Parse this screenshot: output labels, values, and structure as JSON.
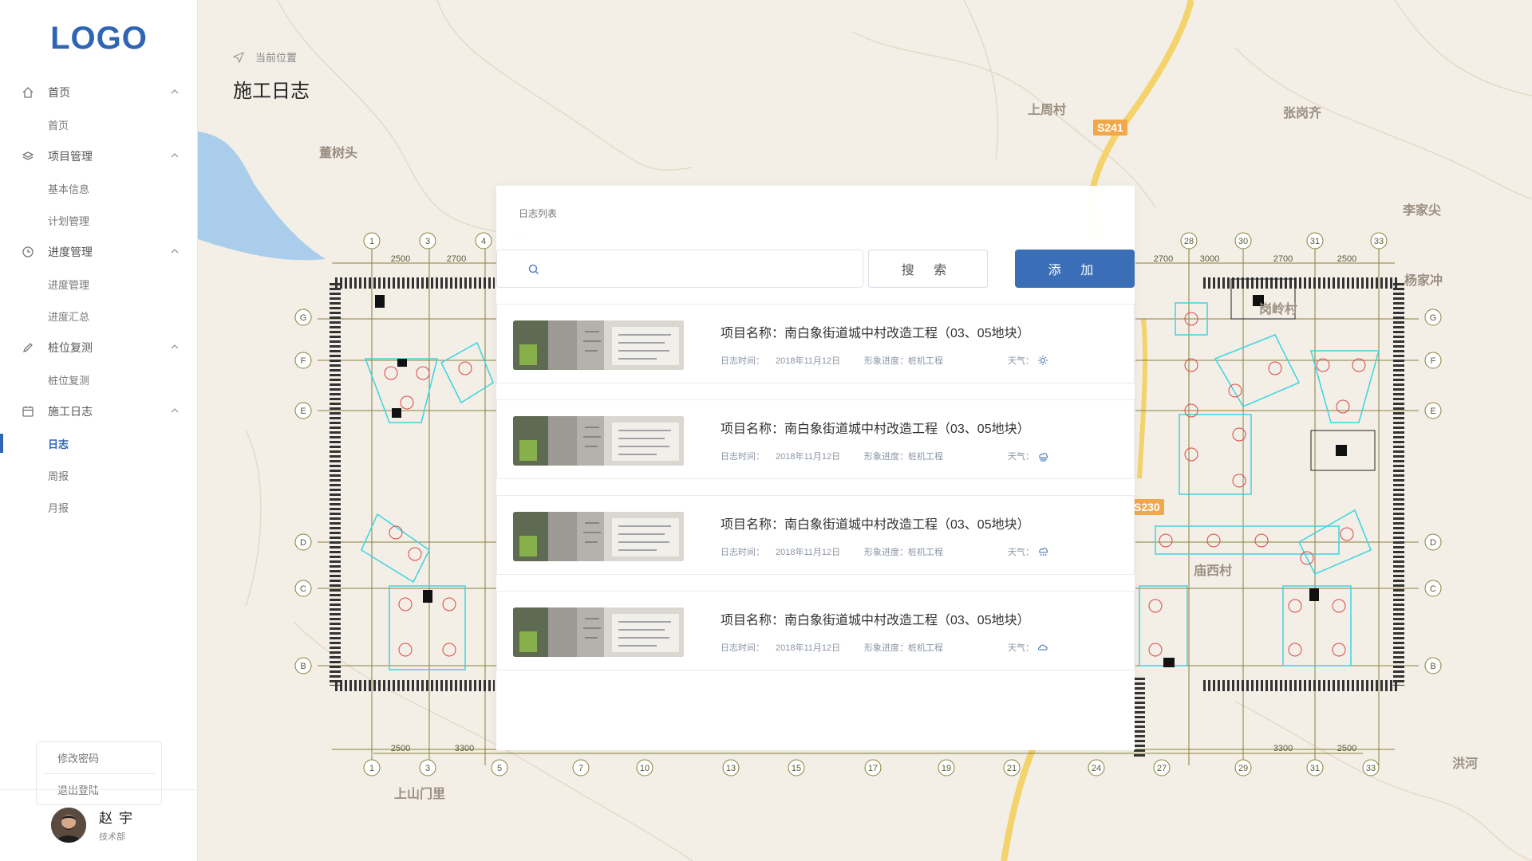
{
  "sidebar": {
    "logo": "LOGO",
    "groups": [
      {
        "label": "首页",
        "icon": "home-icon",
        "items": [
          "首页"
        ]
      },
      {
        "label": "项目管理",
        "icon": "layers-icon",
        "items": [
          "基本信息",
          "计划管理"
        ]
      },
      {
        "label": "进度管理",
        "icon": "clock-icon",
        "items": [
          "进度管理",
          "进度汇总"
        ]
      },
      {
        "label": "桩位复测",
        "icon": "pencil-icon",
        "items": [
          "桩位复测"
        ]
      },
      {
        "label": "施工日志",
        "icon": "calendar-icon",
        "items": [
          "日志",
          "周报",
          "月报"
        ]
      }
    ],
    "active_item": "日志",
    "account": {
      "change_password": "修改密码",
      "logout": "退出登陆"
    },
    "user": {
      "name": "赵宇",
      "dept": "技术部"
    }
  },
  "header": {
    "breadcrumb": "当前位置",
    "title": "施工日志"
  },
  "map": {
    "labels": [
      "董树头",
      "上周村",
      "张岗齐",
      "李家尖",
      "杨家冲",
      "岗岭村",
      "庙西村",
      "上山门里",
      "洪河"
    ],
    "roads": [
      "S241",
      "S230"
    ]
  },
  "panel": {
    "title": "日志列表",
    "search": {
      "placeholder": "",
      "button": "搜 索"
    },
    "add_button": "添 加",
    "logs": [
      {
        "name": "项目名称：南白象街道城中村改造工程（03、05地块）",
        "time_label": "日志时间：",
        "time": "2018年11月12日",
        "progress_label": "形象进度：",
        "progress": "桩机工程",
        "weather_label": "天气：",
        "weather_icon": "sunny-icon"
      },
      {
        "name": "项目名称：南白象街道城中村改造工程（03、05地块）",
        "time_label": "日志时间：",
        "time": "2018年11月12日",
        "progress_label": "形象进度：",
        "progress": "桩机工程",
        "weather_label": "天气：",
        "weather_icon": "cloudy-sun-icon"
      },
      {
        "name": "项目名称：南白象街道城中村改造工程（03、05地块）",
        "time_label": "日志时间：",
        "time": "2018年11月12日",
        "progress_label": "形象进度：",
        "progress": "桩机工程",
        "weather_label": "天气：",
        "weather_icon": "rain-icon"
      },
      {
        "name": "项目名称：南白象街道城中村改造工程（03、05地块）",
        "time_label": "日志时间：",
        "time": "2018年11月12日",
        "progress_label": "形象进度：",
        "progress": "桩机工程",
        "weather_label": "天气：",
        "weather_icon": "cloud-icon"
      }
    ]
  },
  "colors": {
    "accent": "#3a6fb7",
    "logo": "#2f65b3"
  }
}
